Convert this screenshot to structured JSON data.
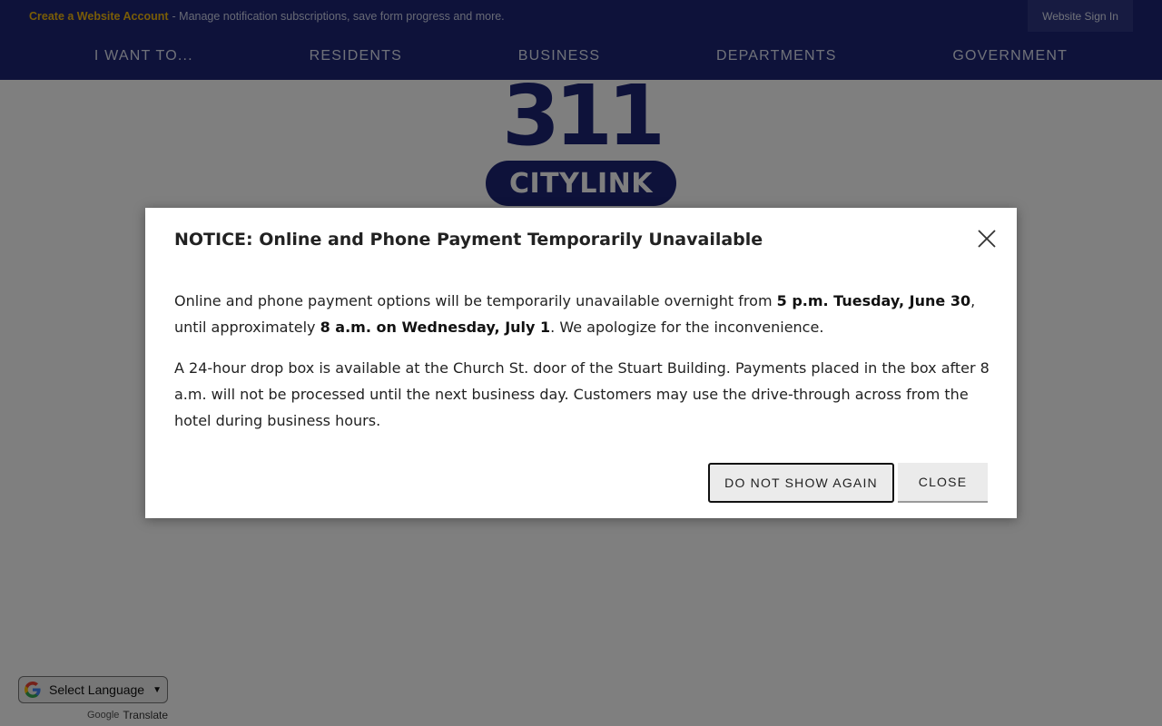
{
  "account_bar": {
    "create_link": "Create a Website Account",
    "description": "- Manage notification subscriptions, save form progress and more.",
    "sign_in": "Website Sign In"
  },
  "nav": {
    "items": [
      "I WANT TO...",
      "RESIDENTS",
      "BUSINESS",
      "DEPARTMENTS",
      "GOVERNMENT"
    ]
  },
  "logo": {
    "number": "311",
    "name": "CITYLINK"
  },
  "translate": {
    "select_label": "Select Language",
    "powered_by_brand": "Google",
    "powered_by_text": "Translate"
  },
  "modal": {
    "title": "NOTICE: Online and Phone Payment Temporarily Unavailable",
    "p1_a": "Online and phone payment options will be temporarily unavailable overnight from ",
    "p1_b": "5 p.m. Tuesday, June 30",
    "p1_c": ", until approximately ",
    "p1_d": "8 a.m. on Wednesday, July 1",
    "p1_e": ". We apologize for the inconvenience.",
    "p2": "A 24-hour drop box is available at the Church St. door of the Stuart Building. Payments placed in the box after 8 a.m. will not be processed until the next business day. Customers may use the drive-through across from the hotel during business hours.",
    "btn_dont_show": "DO NOT SHOW AGAIN",
    "btn_close": "CLOSE"
  },
  "colors": {
    "brand_navy": "#1c2575",
    "account_link": "#f2b90f"
  },
  "icons": [
    "close-icon",
    "google-g-icon",
    "chevron-down-icon"
  ]
}
